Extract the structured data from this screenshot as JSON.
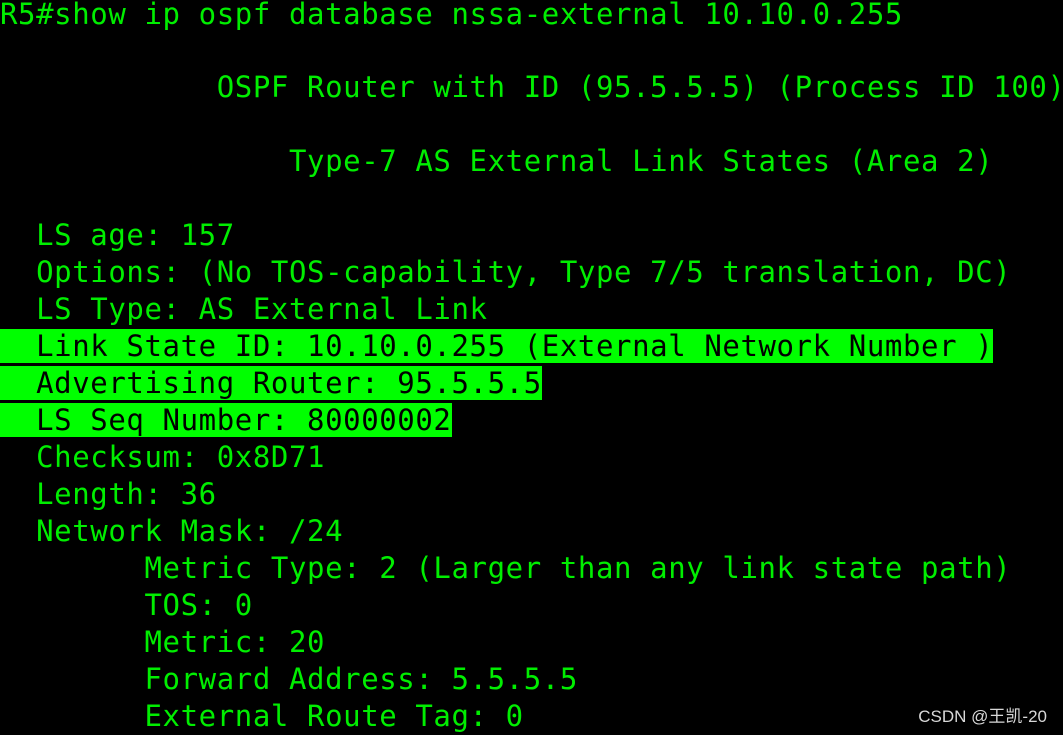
{
  "terminal": {
    "prompt": "R5#",
    "command": "show ip ospf database nssa-external 10.10.0.255",
    "colors": {
      "background": "#000000",
      "text": "#00ee00",
      "highlight_bg": "#00ff00",
      "highlight_text": "#000000"
    },
    "lines": [
      {
        "text": "R5#show ip ospf database nssa-external 10.10.0.255",
        "highlighted": false
      },
      {
        "text": "",
        "highlighted": false
      },
      {
        "text": "            OSPF Router with ID (95.5.5.5) (Process ID 100)",
        "highlighted": false
      },
      {
        "text": "",
        "highlighted": false
      },
      {
        "text": "                Type-7 AS External Link States (Area 2)",
        "highlighted": false
      },
      {
        "text": "",
        "highlighted": false
      },
      {
        "text": "  LS age: 157",
        "highlighted": false
      },
      {
        "text": "  Options: (No TOS-capability, Type 7/5 translation, DC)",
        "highlighted": false
      },
      {
        "text": "  LS Type: AS External Link",
        "highlighted": false
      },
      {
        "text": "  Link State ID: 10.10.0.255 (External Network Number )",
        "highlighted": true
      },
      {
        "text": "  Advertising Router: 95.5.5.5",
        "highlighted": true
      },
      {
        "text": "  LS Seq Number: 80000002",
        "highlighted": true
      },
      {
        "text": "  Checksum: 0x8D71",
        "highlighted": false
      },
      {
        "text": "  Length: 36",
        "highlighted": false
      },
      {
        "text": "  Network Mask: /24",
        "highlighted": false
      },
      {
        "text": "        Metric Type: 2 (Larger than any link state path)",
        "highlighted": false
      },
      {
        "text": "        TOS: 0",
        "highlighted": false
      },
      {
        "text": "        Metric: 20",
        "highlighted": false
      },
      {
        "text": "        Forward Address: 5.5.5.5",
        "highlighted": false
      },
      {
        "text": "        External Route Tag: 0",
        "highlighted": false
      }
    ]
  },
  "watermark": "CSDN @王凯-20"
}
